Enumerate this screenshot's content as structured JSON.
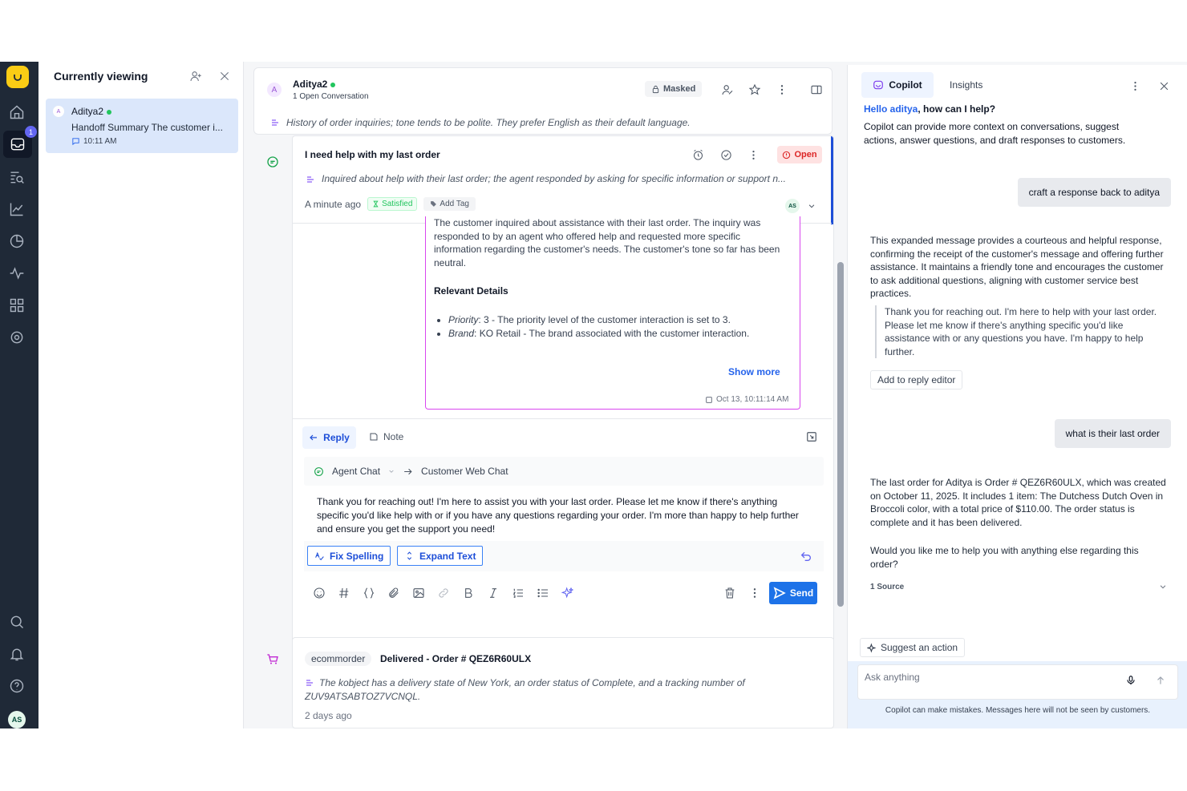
{
  "sidebar": {
    "inbox_badge": "1",
    "avatar_initials": "AS"
  },
  "viewing": {
    "title": "Currently viewing",
    "item": {
      "avatar": "A",
      "name": "Aditya2",
      "summary": "Handoff Summary The customer i...",
      "time": "10:11 AM"
    }
  },
  "conversation": {
    "avatar": "A",
    "name": "Aditya2",
    "sub": "1 Open Conversation",
    "masked_label": "Masked",
    "context": "History of order inquiries; tone tends to be polite. They prefer English as their default language."
  },
  "message": {
    "title": "I need help with my last order",
    "status": "Open",
    "inquiry": "Inquired about help with their last order; the agent responded by asking for specific information or support n...",
    "time_ago": "A minute ago",
    "sentiment": "Satisfied",
    "add_tag": "Add Tag",
    "assignee_initials": "AS",
    "handoff": {
      "text": "The customer inquired about assistance with their last order. The inquiry was responded to by an agent who offered help and requested more specific information regarding the customer's needs. The customer's tone so far has been neutral.",
      "relevant_title": "Relevant Details",
      "details": [
        {
          "key": "Priority",
          "value": ": 3 - The priority level of the customer interaction is set to 3."
        },
        {
          "key": "Brand",
          "value": ": KO Retail - The brand associated with the customer interaction."
        }
      ],
      "show_more": "Show more",
      "timestamp": "Oct 13, 10:11:14 AM"
    }
  },
  "composer": {
    "reply_tab": "Reply",
    "note_tab": "Note",
    "from_channel": "Agent Chat",
    "to_channel": "Customer Web Chat",
    "draft": "Thank you for reaching out! I'm here to assist you with your last order. Please let me know if there's anything specific you'd like help with or if you have any questions regarding your order. I'm more than happy to help further and ensure you get the support you need!",
    "fix_spelling": "Fix Spelling",
    "expand_text": "Expand Text",
    "send": "Send"
  },
  "order": {
    "tag": "ecommorder",
    "title": "Delivered - Order # QEZ6R60ULX",
    "description": "The kobject has a delivery state of New York, an order status of Complete, and a tracking number of ZUV9ATSABTOZ7VCNQL.",
    "time": "2 days ago"
  },
  "copilot": {
    "tab_copilot": "Copilot",
    "tab_insights": "Insights",
    "hello_prefix": "Hello ",
    "hello_user": "aditya",
    "hello_suffix": ", how can I help?",
    "intro": "Copilot can provide more context on conversations, suggest actions, answer questions, and draft responses to customers.",
    "user_msg_1": "craft a response back to aditya",
    "ai_msg_1": "This expanded message provides a courteous and helpful response, confirming the receipt of the customer's message and offering further assistance. It maintains a friendly tone and encourages the customer to ask additional questions, aligning with customer service best practices.",
    "quote": "Thank you for reaching out. I'm here to help with your last order. Please let me know if there's anything specific you'd like assistance with or any questions you have. I'm happy to help further.",
    "add_to_reply": "Add to reply editor",
    "user_msg_2": "what is their last order",
    "ai_msg_2": "The last order for Aditya is Order # QEZ6R60ULX, which was created on October 11, 2025. It includes 1 item: The Dutchess Dutch Oven in Broccoli color, with a total price of $110.00. The order status is complete and it has been delivered.",
    "ai_msg_3": "Would you like me to help you with anything else regarding this order?",
    "source": "1 Source",
    "suggest": "Suggest an action",
    "ask_placeholder": "Ask anything",
    "disclaimer": "Copilot can make mistakes. Messages here will not be seen by customers."
  },
  "colors": {
    "rail": "#1f2937",
    "accent": "#1d72e8",
    "open": "#dc2626",
    "logo": "#facc15"
  }
}
